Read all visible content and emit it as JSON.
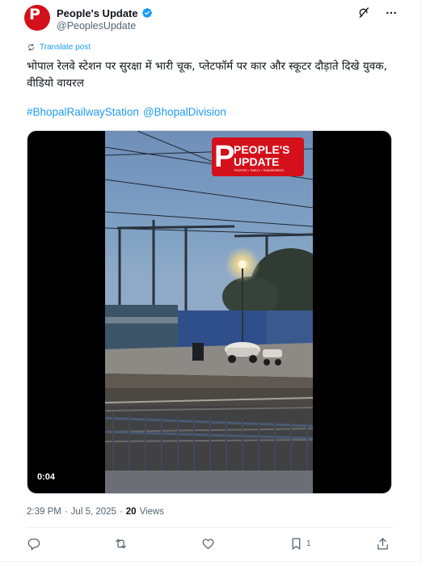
{
  "author": {
    "display_name": "People's Update",
    "handle": "@PeoplesUpdate",
    "avatar_text": "P",
    "avatar_subtext": "PEOPLE'S UPDATE",
    "verified": true
  },
  "header_icons": [
    "grok-icon",
    "more-icon"
  ],
  "translate_label": "Translate post",
  "tweet": {
    "text": "भोपाल रेलवे स्टेशन पर सुरक्षा में भारी चूक, प्लेटफॉर्म पर कार और स्कूटर दौड़ाते दिखे युवक, वीडियो वायरल",
    "hashtags": [
      "#BhopalRailwayStation",
      "@BhopalDivision"
    ]
  },
  "media": {
    "logo_line1": "PEOPLE'S",
    "logo_line2": "UPDATE",
    "logo_tagline": "TRUSTED • TIMELY • TRANSPARENT",
    "duration": "0:04"
  },
  "meta": {
    "time": "2:39 PM",
    "date": "Jul 5, 2025",
    "separator": "·",
    "views_count": "20",
    "views_label": "Views"
  },
  "actions": {
    "reply_count": "",
    "retweet_count": "",
    "like_count": "",
    "bookmark_count": "1"
  },
  "colors": {
    "brand_red": "#d4101a",
    "link_blue": "#1d9bf0",
    "secondary_text": "#536471"
  }
}
